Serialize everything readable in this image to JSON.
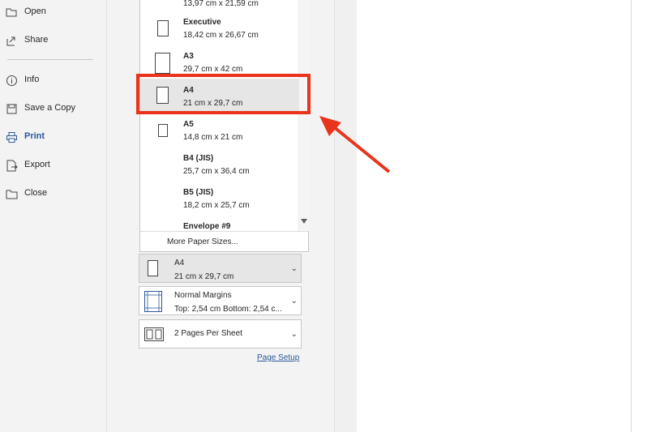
{
  "nav": {
    "items": [
      {
        "label": "Open",
        "icon": "folder-open-icon"
      },
      {
        "label": "Share",
        "icon": "share-icon"
      },
      {
        "label": "Info",
        "icon": "info-icon"
      },
      {
        "label": "Save a Copy",
        "icon": "save-copy-icon"
      },
      {
        "label": "Print",
        "icon": "printer-icon",
        "active": true
      },
      {
        "label": "Export",
        "icon": "export-icon"
      },
      {
        "label": "Close",
        "icon": "close-folder-icon"
      }
    ]
  },
  "paper_list": {
    "partial_top": "13,97 cm x 21,59 cm",
    "items": [
      {
        "name": "Executive",
        "dims": "18,42 cm x 26,67 cm"
      },
      {
        "name": "A3",
        "dims": "29,7 cm x 42 cm"
      },
      {
        "name": "A4",
        "dims": "21 cm x 29,7 cm",
        "selected": true
      },
      {
        "name": "A5",
        "dims": "14,8 cm x 21 cm"
      },
      {
        "name": "B4 (JIS)",
        "dims": "25,7 cm x 36,4 cm"
      },
      {
        "name": "B5 (JIS)",
        "dims": "18,2 cm x 25,7 cm"
      },
      {
        "name": "Envelope #9",
        "dims": ""
      }
    ],
    "more_label": "More Paper Sizes..."
  },
  "settings": {
    "paper": {
      "line1": "A4",
      "line2": "21 cm x 29,7 cm"
    },
    "margins": {
      "line1": "Normal Margins",
      "line2": "Top: 2,54 cm Bottom: 2,54 c..."
    },
    "pages_per_sheet": {
      "line1": "2 Pages Per Sheet"
    },
    "page_setup_link": "Page Setup"
  },
  "colors": {
    "accent": "#2b579a",
    "highlight": "#e8341c"
  }
}
